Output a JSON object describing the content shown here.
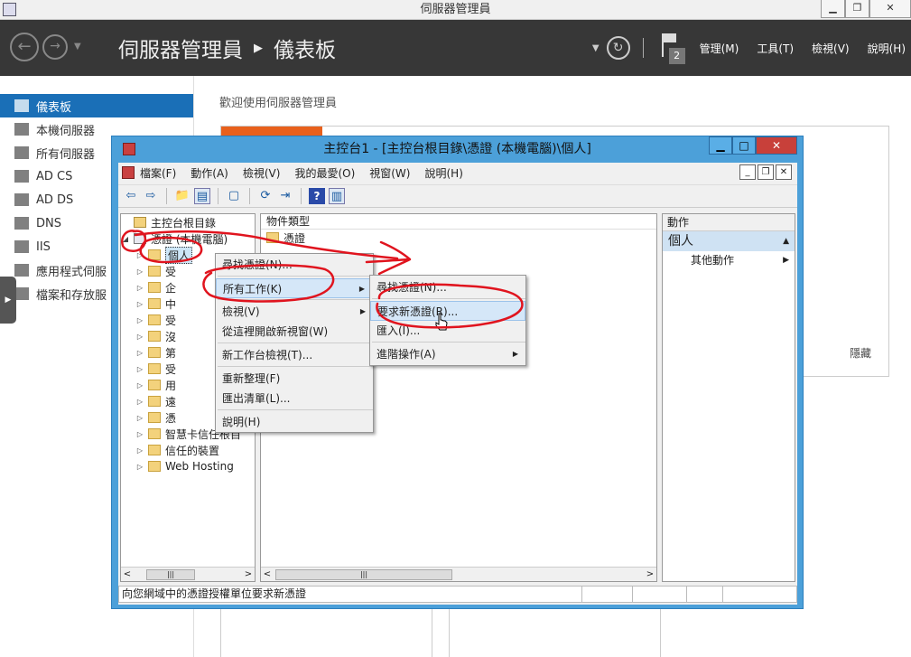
{
  "server_manager": {
    "window_title": "伺服器管理員",
    "breadcrumb": {
      "root": "伺服器管理員",
      "current": "儀表板"
    },
    "menus": [
      "管理(M)",
      "工具(T)",
      "檢視(V)",
      "說明(H)"
    ],
    "notification_count": "2",
    "nav": [
      "儀表板",
      "本機伺服器",
      "所有伺服器",
      "AD CS",
      "AD DS",
      "DNS",
      "IIS",
      "應用程式伺服",
      "檔案和存放服"
    ],
    "welcome": "歡迎使用伺服器管理員",
    "hide_label": "隱藏"
  },
  "mmc": {
    "title": "主控台1 - [主控台根目錄\\憑證 (本機電腦)\\個人]",
    "menubar": [
      "檔案(F)",
      "動作(A)",
      "檢視(V)",
      "我的最愛(O)",
      "視窗(W)",
      "說明(H)"
    ],
    "tree": {
      "root": "主控台根目錄",
      "cert_root": "憑證 (本機電腦)",
      "selected": "個人",
      "items": [
        "受",
        "企",
        "中",
        "受",
        "沒",
        "第",
        "受",
        "用",
        "遠",
        "憑",
        "智慧卡信任根目",
        "信任的裝置",
        "Web Hosting"
      ]
    },
    "list": {
      "header": "物件類型",
      "rows": [
        "憑證"
      ]
    },
    "actions": {
      "header": "動作",
      "section": "個人",
      "items": [
        "其他動作"
      ]
    },
    "status": "向您網域中的憑證授權單位要求新憑證"
  },
  "context_menu": {
    "items": [
      "尋找憑證(N)...",
      "所有工作(K)",
      "檢視(V)",
      "從這裡開啟新視窗(W)",
      "新工作台檢視(T)...",
      "重新整理(F)",
      "匯出清單(L)...",
      "說明(H)"
    ]
  },
  "submenu": {
    "items": [
      "尋找憑證(N)...",
      "要求新憑證(R)...",
      "匯入(I)...",
      "進階操作(A)"
    ]
  },
  "colors": {
    "header_bg": "#373737",
    "nav_active": "#1a6fb7",
    "mmc_frame": "#4ca0d9",
    "annotation": "#e0141e",
    "tile_accent": "#e8601c"
  }
}
